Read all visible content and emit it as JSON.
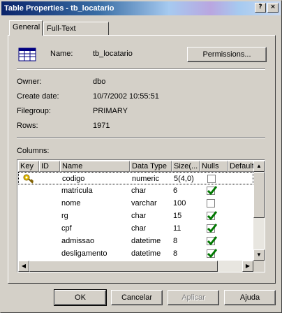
{
  "window": {
    "title": "Table Properties - tb_locatario",
    "help": "?",
    "close": "×"
  },
  "tabs": [
    {
      "label": "General"
    },
    {
      "label": "Full-Text Indexing"
    }
  ],
  "general": {
    "name_label": "Name:",
    "name_value": "tb_locatario",
    "permissions_button": "Permissions...",
    "owner_label": "Owner:",
    "owner_value": "dbo",
    "create_label": "Create date:",
    "create_value": "10/7/2002 10:55:51",
    "filegroup_label": "Filegroup:",
    "filegroup_value": "PRIMARY",
    "rows_label": "Rows:",
    "rows_value": "1971",
    "columns_label": "Columns:"
  },
  "grid": {
    "headers": [
      "Key",
      "ID",
      "Name",
      "Data Type",
      "Size(...",
      "Nulls",
      "Default"
    ],
    "rows": [
      {
        "key": true,
        "name": "codigo",
        "type": "numeric",
        "size": "5(4,0)",
        "nulls": false
      },
      {
        "key": false,
        "name": "matricula",
        "type": "char",
        "size": "6",
        "nulls": true
      },
      {
        "key": false,
        "name": "nome",
        "type": "varchar",
        "size": "100",
        "nulls": false
      },
      {
        "key": false,
        "name": "rg",
        "type": "char",
        "size": "15",
        "nulls": true
      },
      {
        "key": false,
        "name": "cpf",
        "type": "char",
        "size": "11",
        "nulls": true
      },
      {
        "key": false,
        "name": "admissao",
        "type": "datetime",
        "size": "8",
        "nulls": true
      },
      {
        "key": false,
        "name": "desligamento",
        "type": "datetime",
        "size": "8",
        "nulls": true
      }
    ]
  },
  "footer": {
    "ok": "OK",
    "cancel": "Cancelar",
    "apply": "Aplicar",
    "help": "Ajuda"
  },
  "colors": {
    "check": "#007800",
    "title_start": "#0a246a"
  }
}
